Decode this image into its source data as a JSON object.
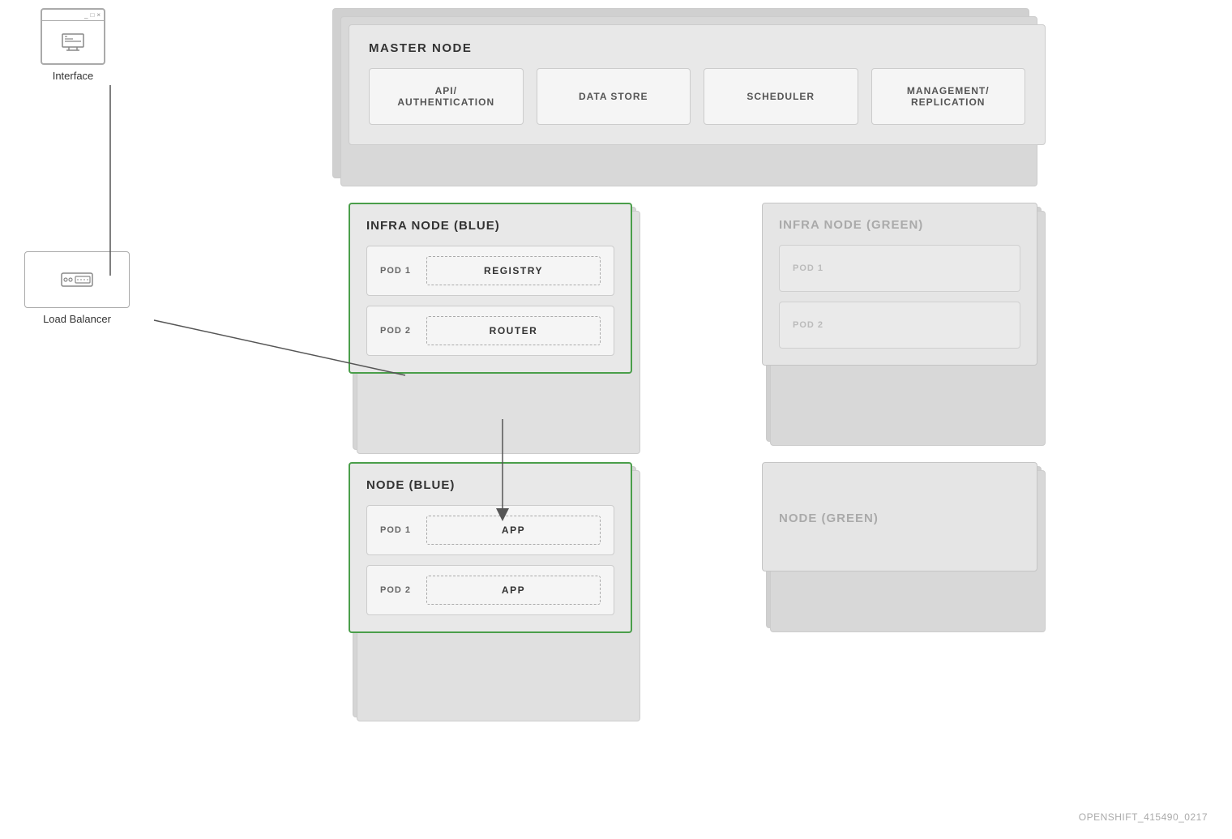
{
  "interface": {
    "label": "Interface"
  },
  "loadBalancer": {
    "label": "Load Balancer"
  },
  "masterNode": {
    "title": "MASTER NODE",
    "components": [
      {
        "label": "API/\nAUTHENTICATION"
      },
      {
        "label": "DATA STORE"
      },
      {
        "label": "SCHEDULER"
      },
      {
        "label": "MANAGEMENT/\nREPLICATION"
      }
    ]
  },
  "infraNodeBlue": {
    "title": "INFRA NODE (BLUE)",
    "pods": [
      {
        "label": "POD 1",
        "component": "REGISTRY"
      },
      {
        "label": "POD 2",
        "component": "ROUTER"
      }
    ]
  },
  "nodeBlue": {
    "title": "NODE (BLUE)",
    "pods": [
      {
        "label": "POD 1",
        "component": "APP"
      },
      {
        "label": "POD 2",
        "component": "APP"
      }
    ]
  },
  "infraNodeGreen": {
    "title": "INFRA NODE (GREEN)",
    "pods": [
      {
        "label": "POD 1"
      },
      {
        "label": "POD 2"
      }
    ]
  },
  "nodeGreen": {
    "title": "NODE (GREEN)"
  },
  "watermark": {
    "text": "OPENSHIFT_415490_0217"
  }
}
